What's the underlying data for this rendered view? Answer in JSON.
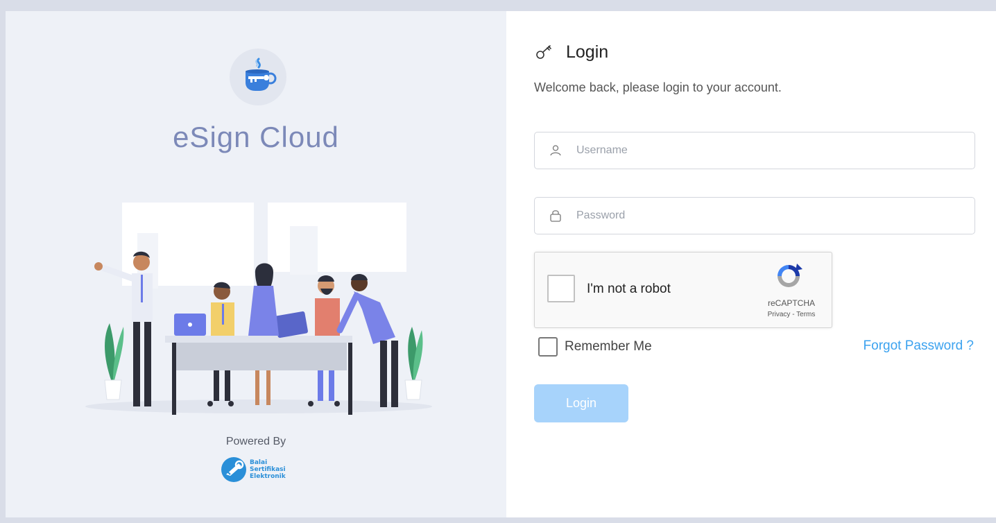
{
  "brand": {
    "name": "eSign  Cloud",
    "logo_icon": "coffee-cup-key-icon"
  },
  "powered": {
    "label": "Powered By",
    "org_lines": [
      "Balai",
      "Sertifikasi",
      "Elektronik"
    ]
  },
  "login": {
    "title": "Login",
    "title_icon": "key-icon",
    "welcome": "Welcome back, please login to your account.",
    "username_placeholder": "Username",
    "password_placeholder": "Password",
    "captcha_label": "I'm not a robot",
    "captcha_brand": "reCAPTCHA",
    "captcha_links": "Privacy - Terms",
    "remember_label": "Remember Me",
    "forgot_label": "Forgot Password ?",
    "submit_label": "Login"
  },
  "colors": {
    "accent": "#3ba2ef",
    "button_disabled": "#a7d3fb",
    "brand_text": "#7c89b8",
    "left_panel": "#eef1f7"
  }
}
